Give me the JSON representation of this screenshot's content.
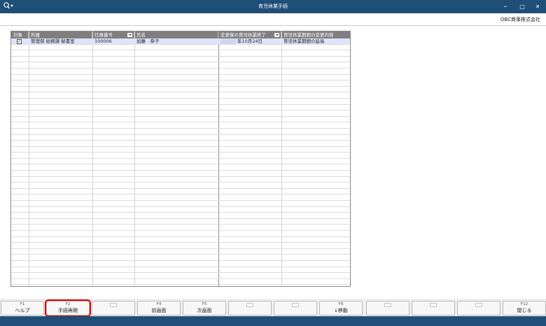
{
  "window": {
    "title": "育児休業手続",
    "minimize": "–",
    "maximize": "□",
    "close": "✕"
  },
  "company": "OBC商事株式会社",
  "grid": {
    "columns": [
      {
        "label": "対象",
        "sortable": false
      },
      {
        "label": "所属",
        "sortable": false
      },
      {
        "label": "社員番号",
        "sortable": true
      },
      {
        "label": "氏名",
        "sortable": false
      },
      {
        "label": "変更後の育児休業終了",
        "sortable": true
      },
      {
        "label": "育児休業期間の変更内容",
        "sortable": false
      }
    ],
    "rows": [
      {
        "checked": true,
        "check_mark": "✓",
        "dept": "管理部 総務課 秘書室",
        "emp_no": "100006",
        "name": "加藤　恭子",
        "end_date": "年10月24日",
        "change": "育児休業期間の延長"
      }
    ]
  },
  "fkeys": [
    {
      "key": "F1",
      "label": "ヘルプ",
      "empty": false
    },
    {
      "key": "F2",
      "label": "手続再開",
      "empty": false,
      "highlight": true
    },
    {
      "key": "",
      "label": "",
      "empty": true
    },
    {
      "key": "F4",
      "label": "前画面",
      "empty": false
    },
    {
      "key": "F5",
      "label": "次画面",
      "empty": false
    },
    {
      "key": "",
      "label": "",
      "empty": true
    },
    {
      "key": "",
      "label": "",
      "empty": true
    },
    {
      "key": "F8",
      "label": "↓移動",
      "empty": false
    },
    {
      "key": "",
      "label": "",
      "empty": true
    },
    {
      "key": "",
      "label": "",
      "empty": true
    },
    {
      "key": "",
      "label": "",
      "empty": true
    },
    {
      "key": "F12",
      "label": "閉じる",
      "empty": false
    }
  ],
  "colors": {
    "titlebar": "#1f4e79",
    "header": "#7f7f7f",
    "selected_row": "#dfe3fb",
    "highlight": "#e00000"
  }
}
